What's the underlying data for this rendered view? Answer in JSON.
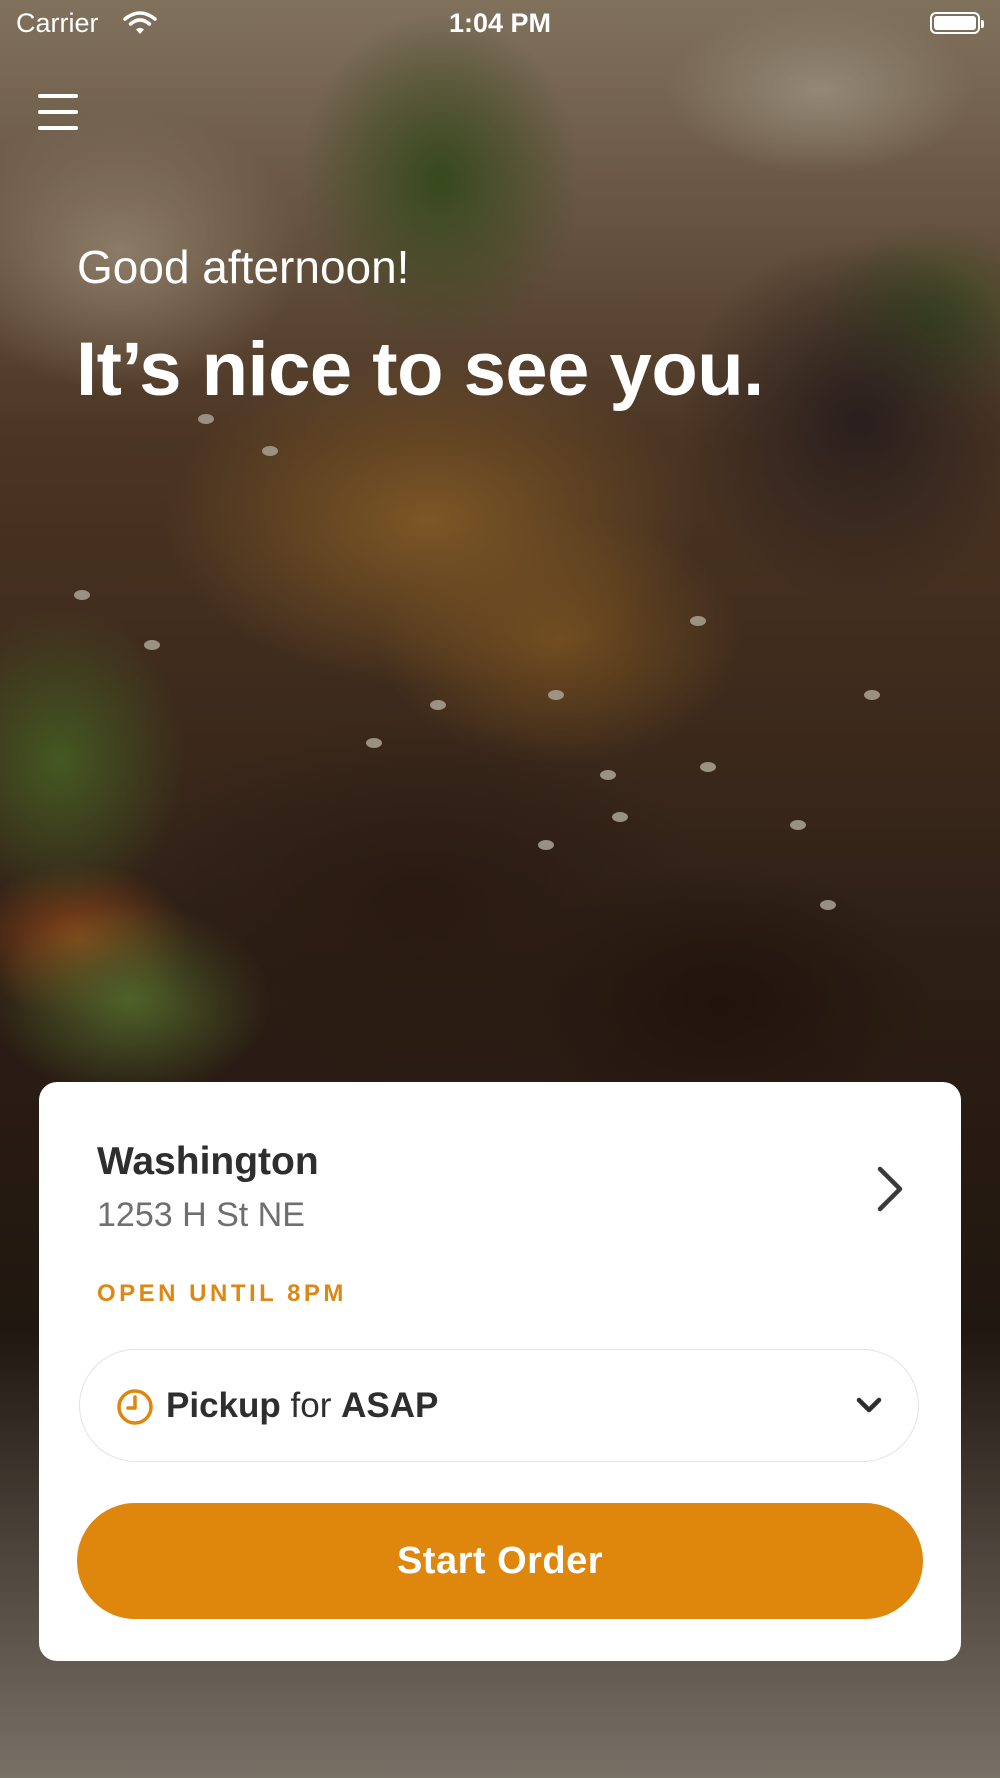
{
  "status_bar": {
    "carrier": "Carrier",
    "time": "1:04 PM",
    "wifi_icon": "wifi-icon",
    "battery_icon": "battery-icon"
  },
  "header": {
    "menu_icon": "hamburger-menu-icon",
    "greeting": "Good afternoon!",
    "headline": "It’s nice to see you."
  },
  "location_card": {
    "name": "Washington",
    "address": "1253 H St NE",
    "chevron_icon": "chevron-right-icon",
    "open_status": "OPEN UNTIL 8PM",
    "pickup_selector": {
      "clock_icon": "clock-icon",
      "mode": "Pickup",
      "connector": "for",
      "time": "ASAP",
      "caret_icon": "chevron-down-icon"
    },
    "start_button_label": "Start Order"
  },
  "colors": {
    "accent": "#df860c",
    "open_status": "#de8714",
    "card_background": "#ffffff",
    "text_dark": "#2e2e2e",
    "text_muted": "#6f6f6f"
  }
}
